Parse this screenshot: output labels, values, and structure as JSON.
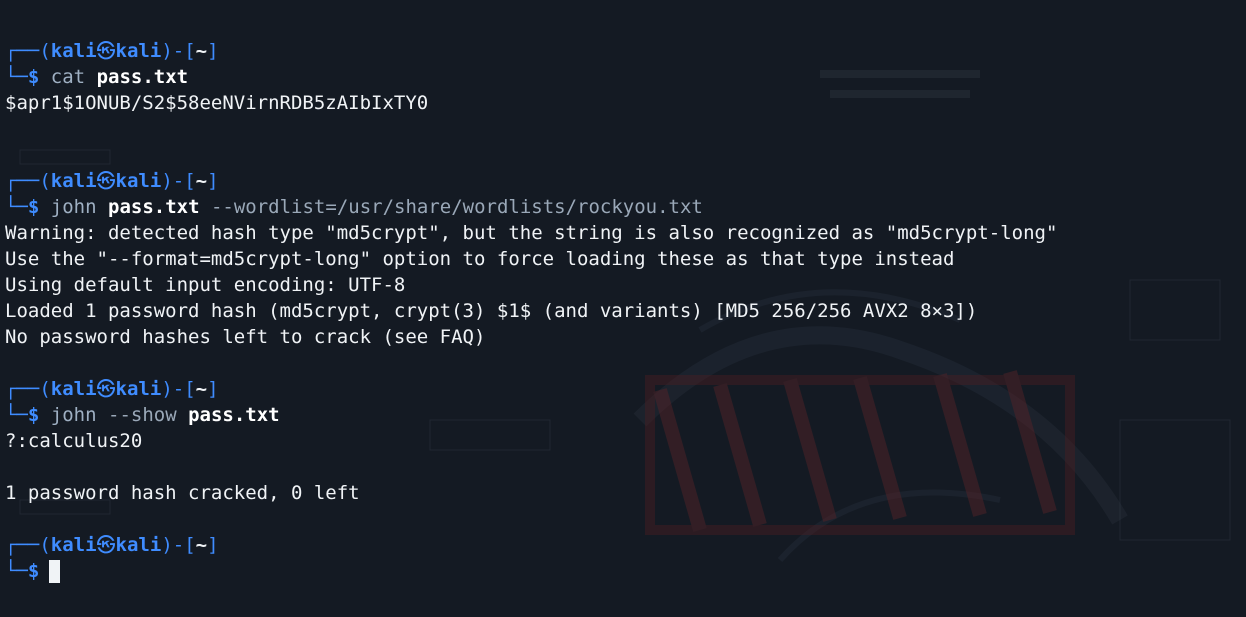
{
  "prompt": {
    "user": "kali",
    "host": "kali",
    "at_symbol": "㉿",
    "dir": "~",
    "symbol": "$"
  },
  "blocks": [
    {
      "command": {
        "name": "cat",
        "args": "pass.txt",
        "options": ""
      },
      "output": [
        "$apr1$1ONUB/S2$58eeNVirnRDB5zAIbIxTY0"
      ]
    },
    {
      "command": {
        "name": "john",
        "args": "pass.txt",
        "options": "--wordlist=/usr/share/wordlists/rockyou.txt"
      },
      "output": [
        "Warning: detected hash type \"md5crypt\", but the string is also recognized as \"md5crypt-long\"",
        "Use the \"--format=md5crypt-long\" option to force loading these as that type instead",
        "Using default input encoding: UTF-8",
        "Loaded 1 password hash (md5crypt, crypt(3) $1$ (and variants) [MD5 256/256 AVX2 8×3])",
        "No password hashes left to crack (see FAQ)"
      ]
    },
    {
      "command": {
        "name": "john",
        "options": "--show",
        "args": "pass.txt"
      },
      "output": [
        "?:calculus20",
        "",
        "1 password hash cracked, 0 left"
      ]
    }
  ],
  "colors": {
    "background": "#141a23",
    "prompt_blue": "#3f8cff",
    "text": "#f0f3f6"
  },
  "icons": [
    "kali-dragon-wallpaper"
  ]
}
